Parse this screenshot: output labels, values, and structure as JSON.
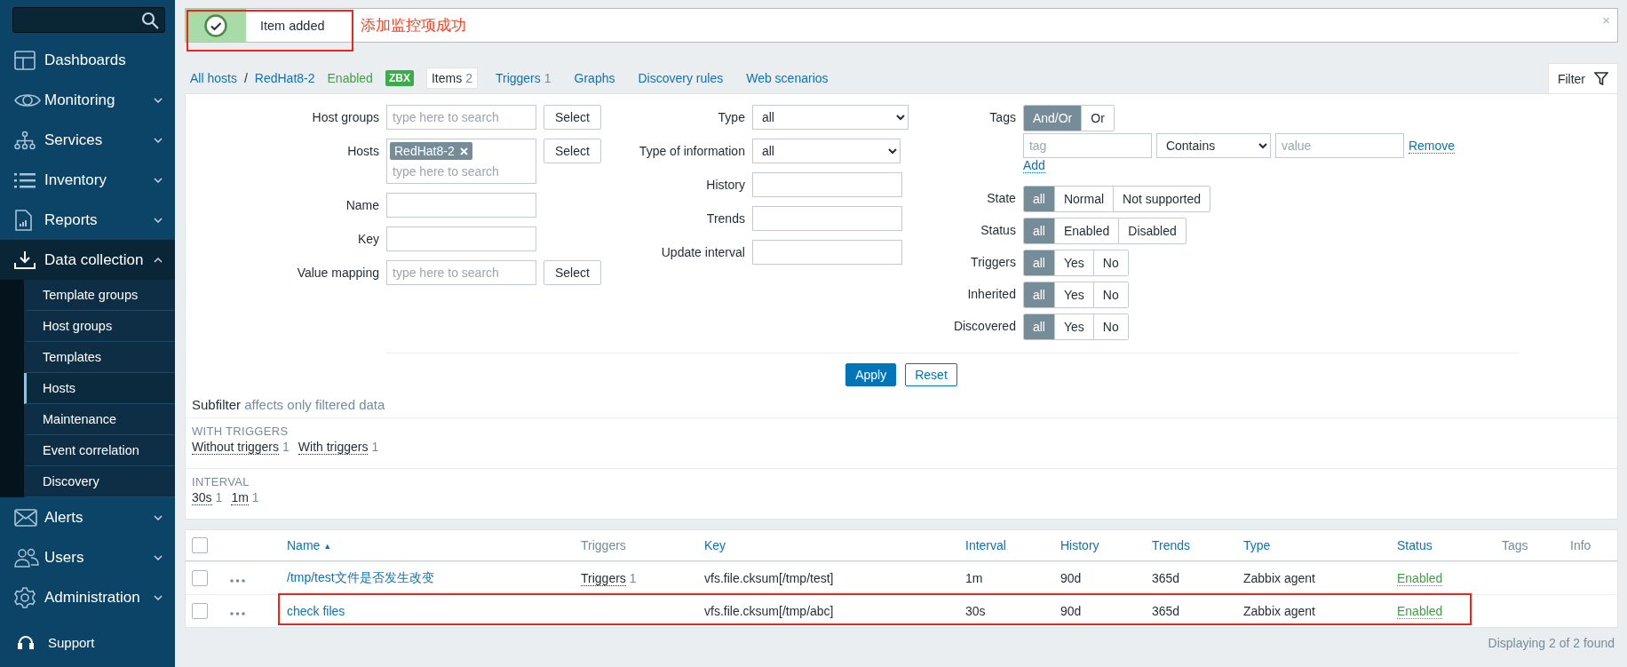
{
  "sidebar": {
    "items": [
      {
        "label": "Dashboards",
        "kind": "link",
        "expanded": false
      },
      {
        "label": "Monitoring",
        "kind": "menu",
        "expanded": false
      },
      {
        "label": "Services",
        "kind": "menu",
        "expanded": false
      },
      {
        "label": "Inventory",
        "kind": "menu",
        "expanded": false
      },
      {
        "label": "Reports",
        "kind": "menu",
        "expanded": false
      },
      {
        "label": "Data collection",
        "kind": "menu",
        "expanded": true,
        "children": [
          {
            "label": "Template groups",
            "selected": false
          },
          {
            "label": "Host groups",
            "selected": false
          },
          {
            "label": "Templates",
            "selected": false
          },
          {
            "label": "Hosts",
            "selected": true
          },
          {
            "label": "Maintenance",
            "selected": false
          },
          {
            "label": "Event correlation",
            "selected": false
          },
          {
            "label": "Discovery",
            "selected": false
          }
        ]
      },
      {
        "label": "Alerts",
        "kind": "menu",
        "expanded": false
      },
      {
        "label": "Users",
        "kind": "menu",
        "expanded": false
      },
      {
        "label": "Administration",
        "kind": "menu",
        "expanded": false
      }
    ],
    "support": {
      "label": "Support"
    }
  },
  "notice": {
    "message": "Item added",
    "kind": "success",
    "highlighted": true,
    "close": "×",
    "annotation": "添加监控项成功"
  },
  "breadcrumbs": [
    {
      "kind": "link",
      "label": "All hosts"
    },
    {
      "kind": "separator",
      "label": "/"
    },
    {
      "kind": "link",
      "label": "RedHat8-2"
    },
    {
      "kind": "status",
      "label": "Enabled"
    },
    {
      "kind": "badge",
      "label": "ZBX"
    },
    {
      "kind": "tab",
      "label": "Items",
      "count": "2",
      "selected": true
    },
    {
      "kind": "tab",
      "label": "Triggers",
      "count": "1",
      "selected": false
    },
    {
      "kind": "tab",
      "label": "Graphs",
      "selected": false
    },
    {
      "kind": "tab",
      "label": "Discovery rules",
      "selected": false
    },
    {
      "kind": "tab",
      "label": "Web scenarios",
      "selected": false
    }
  ],
  "filter_tab": {
    "label": "Filter"
  },
  "filter": {
    "left": [
      {
        "label": "Host groups",
        "kind": "multiselect",
        "placeholder": "type here to search",
        "button": "Select"
      },
      {
        "label": "Hosts",
        "kind": "multiselect",
        "tags": [
          "RedHat8-2"
        ],
        "placeholder": "type here to search",
        "button": "Select"
      },
      {
        "label": "Name",
        "kind": "text"
      },
      {
        "label": "Key",
        "kind": "text"
      },
      {
        "label": "Value mapping",
        "kind": "multiselect",
        "placeholder": "type here to search",
        "button": "Select"
      }
    ],
    "middle": [
      {
        "label": "Type",
        "kind": "select",
        "value": "all"
      },
      {
        "label": "Type of information",
        "kind": "select",
        "value": "all"
      },
      {
        "label": "History",
        "kind": "text"
      },
      {
        "label": "Trends",
        "kind": "text"
      },
      {
        "label": "Update interval",
        "kind": "text"
      }
    ],
    "tags": {
      "label": "Tags",
      "options": [
        {
          "label": "And/Or",
          "selected": true
        },
        {
          "label": "Or",
          "selected": false
        }
      ],
      "row": {
        "tag_placeholder": "tag",
        "operator": "Contains",
        "value_placeholder": "value",
        "remove": "Remove"
      },
      "add": "Add"
    },
    "segments": [
      {
        "label": "State",
        "options": [
          {
            "label": "all",
            "selected": true
          },
          {
            "label": "Normal",
            "selected": false
          },
          {
            "label": "Not supported",
            "selected": false
          }
        ]
      },
      {
        "label": "Status",
        "options": [
          {
            "label": "all",
            "selected": true
          },
          {
            "label": "Enabled",
            "selected": false
          },
          {
            "label": "Disabled",
            "selected": false
          }
        ]
      },
      {
        "label": "Triggers",
        "options": [
          {
            "label": "all",
            "selected": true
          },
          {
            "label": "Yes",
            "selected": false
          },
          {
            "label": "No",
            "selected": false
          }
        ]
      },
      {
        "label": "Inherited",
        "options": [
          {
            "label": "all",
            "selected": true
          },
          {
            "label": "Yes",
            "selected": false
          },
          {
            "label": "No",
            "selected": false
          }
        ]
      },
      {
        "label": "Discovered",
        "options": [
          {
            "label": "all",
            "selected": true
          },
          {
            "label": "Yes",
            "selected": false
          },
          {
            "label": "No",
            "selected": false
          }
        ]
      }
    ],
    "buttons": [
      {
        "label": "Apply",
        "kind": "primary"
      },
      {
        "label": "Reset",
        "kind": "secondary"
      }
    ]
  },
  "subfilter": {
    "title": "Subfilter",
    "note": "affects only filtered data",
    "groups": [
      {
        "heading": "WITH TRIGGERS",
        "values": [
          {
            "label": "Without triggers",
            "count": "1"
          },
          {
            "label": "With triggers",
            "count": "1"
          }
        ]
      },
      {
        "heading": "INTERVAL",
        "values": [
          {
            "label": "30s",
            "count": "1"
          },
          {
            "label": "1m",
            "count": "1"
          }
        ]
      }
    ]
  },
  "table": {
    "checked": false,
    "columns": [
      {
        "label": "Name",
        "sortable": true,
        "sort_mark": "▲"
      },
      {
        "label": "Triggers",
        "sortable": false
      },
      {
        "label": "Key",
        "sortable": true
      },
      {
        "label": "Interval",
        "sortable": true
      },
      {
        "label": "History",
        "sortable": true
      },
      {
        "label": "Trends",
        "sortable": true
      },
      {
        "label": "Type",
        "sortable": true
      },
      {
        "label": "Status",
        "sortable": true
      },
      {
        "label": "Tags",
        "sortable": false
      },
      {
        "label": "Info",
        "sortable": false
      }
    ],
    "rows": [
      {
        "checked": false,
        "highlighted": false,
        "name": "/tmp/test文件是否发生改变",
        "triggers": {
          "label": "Triggers",
          "count": "1"
        },
        "key": "vfs.file.cksum[/tmp/test]",
        "interval": "1m",
        "history": "90d",
        "trends": "365d",
        "type": "Zabbix agent",
        "status": "Enabled"
      },
      {
        "checked": false,
        "highlighted": true,
        "name": "check files",
        "key": "vfs.file.cksum[/tmp/abc]",
        "interval": "30s",
        "history": "90d",
        "trends": "365d",
        "type": "Zabbix agent",
        "status": "Enabled"
      }
    ]
  },
  "footer": "Displaying 2 of 2 found"
}
